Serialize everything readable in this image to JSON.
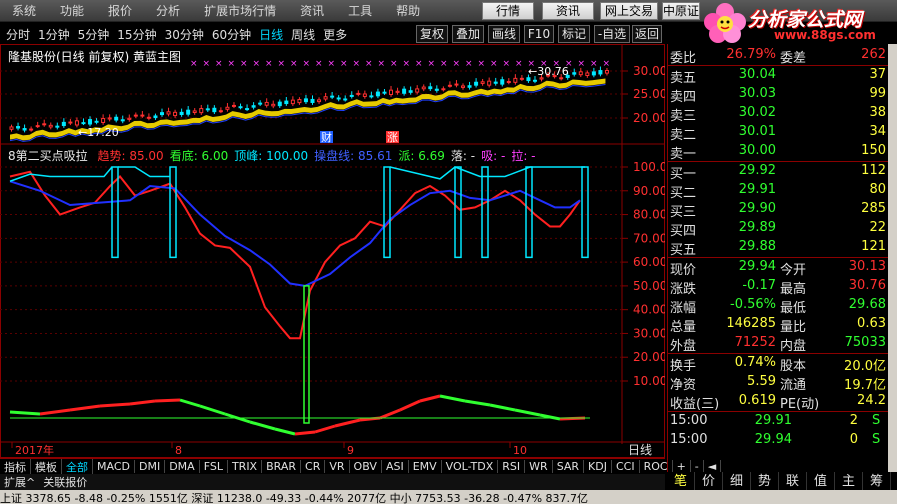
{
  "menu": [
    "系统",
    "功能",
    "报价",
    "分析",
    "扩展市场行情",
    "资讯",
    "工具",
    "帮助"
  ],
  "topbuttons": {
    "quote": "行情",
    "news": "资讯",
    "trade": "网上交易",
    "broker": "中原证"
  },
  "logo": {
    "title": "分析家公式网",
    "url": "www.88gs.com"
  },
  "periods": [
    "分时",
    "1分钟",
    "5分钟",
    "15分钟",
    "30分钟",
    "60分钟",
    "日线",
    "周线",
    "更多"
  ],
  "active_period": "日线",
  "toolbar": [
    "复权",
    "叠加",
    "画线",
    "F10",
    "标记",
    "-自选",
    "返回"
  ],
  "main_title": "隆基股份(日线 前复权) 黄蓝主图",
  "main_labels": {
    "high": "30.76",
    "low": "17.20"
  },
  "main_axis": [
    "30.00",
    "25.00",
    "20.00"
  ],
  "event_markers": [
    "财",
    "涨"
  ],
  "indicator": {
    "title": "8第二买点吸拉",
    "items": [
      {
        "label": "趋势: 85.00",
        "color": "#ff3030"
      },
      {
        "label": "看底: 6.00",
        "color": "#30ff30"
      },
      {
        "label": "顶峰: 100.00",
        "color": "#00e8ff"
      },
      {
        "label": "操盘线: 85.61",
        "color": "#4060ff"
      },
      {
        "label": "派: 6.69",
        "color": "#30ff30"
      },
      {
        "label": "落: -",
        "color": "#e0e0e0"
      },
      {
        "label": "吸: -",
        "color": "#ff40ff"
      },
      {
        "label": "拉: -",
        "color": "#ff40ff"
      }
    ],
    "axis": [
      "100.00",
      "90.00",
      "80.00",
      "70.00",
      "60.00",
      "50.00",
      "40.00",
      "30.00",
      "20.00",
      "10.00"
    ]
  },
  "time_axis": [
    "2017年",
    "8",
    "9",
    "10"
  ],
  "time_axis_right": "日线",
  "quote": {
    "weibi": {
      "label": "委比",
      "value": "26.79%",
      "label2": "委差",
      "value2": "262"
    },
    "asks": [
      {
        "label": "卖五",
        "price": "30.04",
        "vol": "37"
      },
      {
        "label": "卖四",
        "price": "30.03",
        "vol": "99"
      },
      {
        "label": "卖三",
        "price": "30.02",
        "vol": "38"
      },
      {
        "label": "卖二",
        "price": "30.01",
        "vol": "34"
      },
      {
        "label": "卖一",
        "price": "30.00",
        "vol": "150"
      }
    ],
    "bids": [
      {
        "label": "买一",
        "price": "29.92",
        "vol": "112"
      },
      {
        "label": "买二",
        "price": "29.91",
        "vol": "80"
      },
      {
        "label": "买三",
        "price": "29.90",
        "vol": "285"
      },
      {
        "label": "买四",
        "price": "29.89",
        "vol": "22"
      },
      {
        "label": "买五",
        "price": "29.88",
        "vol": "121"
      }
    ],
    "stats": [
      {
        "l1": "现价",
        "v1": "29.94",
        "c1": "#30ff30",
        "l2": "今开",
        "v2": "30.13",
        "c2": "#ff3030"
      },
      {
        "l1": "涨跌",
        "v1": "-0.17",
        "c1": "#30ff30",
        "l2": "最高",
        "v2": "30.76",
        "c2": "#ff3030"
      },
      {
        "l1": "涨幅",
        "v1": "-0.56%",
        "c1": "#30ff30",
        "l2": "最低",
        "v2": "29.68",
        "c2": "#30ff30"
      },
      {
        "l1": "总量",
        "v1": "146285",
        "c1": "#ffff40",
        "l2": "量比",
        "v2": "0.63",
        "c2": "#ffff40"
      },
      {
        "l1": "外盘",
        "v1": "71252",
        "c1": "#ff3030",
        "l2": "内盘",
        "v2": "75033",
        "c2": "#30ff30"
      }
    ],
    "fund": [
      {
        "l1": "换手",
        "v1": "0.74%",
        "l2": "股本",
        "v2": "20.0亿"
      },
      {
        "l1": "净资",
        "v1": "5.59",
        "l2": "流通",
        "v2": "19.7亿"
      },
      {
        "l1": "收益(三)",
        "v1": "0.619",
        "l2": "PE(动)",
        "v2": "24.2"
      }
    ],
    "ticks": [
      {
        "time": "15:00",
        "price": "29.91",
        "vol": "2",
        "flag": "S"
      },
      {
        "time": "15:00",
        "price": "29.94",
        "vol": "0",
        "flag": "S"
      }
    ]
  },
  "indicator_tabs": [
    "指标",
    "模板",
    "全部",
    "MACD",
    "DMI",
    "DMA",
    "FSL",
    "TRIX",
    "BRAR",
    "CR",
    "VR",
    "OBV",
    "ASI",
    "EMV",
    "VOL-TDX",
    "RSI",
    "WR",
    "SAR",
    "KDJ",
    "CCI",
    "ROC"
  ],
  "active_indicator_tab": "全部",
  "indicator_tab_tools": [
    "+",
    "-",
    "◄"
  ],
  "ext_items": [
    "扩展^",
    "关联报价"
  ],
  "right_tabs": [
    "笔",
    "价",
    "细",
    "势",
    "联",
    "值",
    "主",
    "筹"
  ],
  "active_right_tab": "笔",
  "statusbar": "上证 3378.65  -8.48  -0.25%  1551亿  深证 11238.0  -49.33  -0.44%  2077亿  中小 7753.53  -36.28  -0.47%  837.7亿",
  "colors": {
    "up": "#ff3030",
    "down": "#30ff30",
    "price": "#ffff40",
    "cyan": "#00e8ff",
    "blue": "#2040ff",
    "border": "#8b0000"
  }
}
